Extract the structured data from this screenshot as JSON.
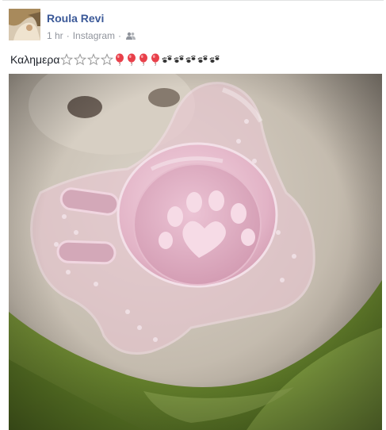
{
  "post": {
    "author": "Roula Revi",
    "time": "1 hr",
    "separator": "·",
    "source": "Instagram",
    "audience_icon": "friends-icon",
    "caption_text": "Καλημερα",
    "caption_emoji": {
      "stars": 4,
      "balloons": 4,
      "paws": 5
    },
    "photo_icon_names": [
      "pacifier-photo"
    ]
  },
  "colors": {
    "author_link": "#3b5998",
    "meta_text": "#90949c",
    "caption_text": "#1d2129",
    "balloon": "#e8404a",
    "pacifier": "#e9b8cd",
    "blanket": "#6f8a32"
  }
}
